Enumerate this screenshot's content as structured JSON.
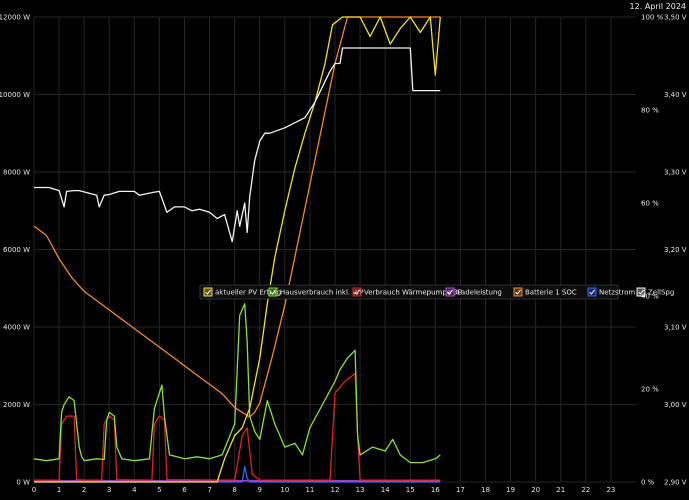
{
  "date_label": "12. April 2024",
  "chart_data": {
    "type": "line",
    "title": "",
    "xlim": [
      0,
      24
    ],
    "x_ticks": [
      "0",
      "1",
      "2",
      "3",
      "4",
      "5",
      "6",
      "7",
      "8",
      "9",
      "10",
      "11",
      "12",
      "13",
      "14",
      "15",
      "16",
      "17",
      "18",
      "19",
      "20",
      "21",
      "22",
      "23"
    ],
    "left_axis": {
      "ylim": [
        0,
        12000
      ],
      "ticks": [
        "0 W",
        "2000 W",
        "4000 W",
        "6000 W",
        "8000 W",
        "10000 W",
        "12000 W"
      ]
    },
    "pct_axis": {
      "ylim": [
        0,
        100
      ],
      "ticks": [
        "0 %",
        "20 %",
        "40 %",
        "60 %",
        "80 %",
        "100 %"
      ]
    },
    "volt_axis": {
      "ylim": [
        2.9,
        3.5
      ],
      "ticks": [
        "2,90 V",
        "3,00 V",
        "3,10 V",
        "3,20 V",
        "3,30 V",
        "3,40 V",
        "3,50 V"
      ]
    },
    "grid": true,
    "legend_position": "center-right",
    "series": [
      {
        "name": "aktueller PV Ertrag",
        "color": "#f2df30",
        "axis": "left",
        "x": [
          0,
          7.3,
          7.6,
          8.0,
          8.3,
          8.6,
          9.0,
          9.3,
          9.6,
          10.0,
          10.4,
          10.8,
          11.2,
          11.6,
          11.9,
          12.3,
          12.7,
          13.0,
          13.4,
          13.8,
          14.2,
          14.6,
          15.0,
          15.4,
          15.8,
          16.0,
          16.2
        ],
        "y": [
          0,
          0,
          600,
          1200,
          1400,
          1900,
          3200,
          4600,
          5800,
          7000,
          8100,
          9000,
          9800,
          10800,
          11800,
          12000,
          12000,
          12000,
          11500,
          12000,
          11300,
          11700,
          12000,
          11600,
          12000,
          10500,
          12000
        ]
      },
      {
        "name": "Hausverbrauch inkl. WP",
        "color": "#86e23c",
        "axis": "left",
        "x": [
          0,
          0.5,
          1.0,
          1.1,
          1.2,
          1.4,
          1.6,
          1.8,
          1.9,
          2.0,
          2.5,
          2.8,
          2.9,
          3.0,
          3.2,
          3.3,
          3.5,
          4.0,
          4.6,
          4.8,
          5.0,
          5.1,
          5.2,
          5.4,
          6.0,
          6.5,
          7.0,
          7.5,
          8.0,
          8.2,
          8.4,
          8.5,
          8.6,
          8.8,
          9.0,
          9.3,
          9.6,
          10.0,
          10.4,
          10.7,
          11.0,
          11.5,
          12.0,
          12.2,
          12.5,
          12.8,
          12.9,
          13.0,
          13.5,
          14.0,
          14.3,
          14.6,
          15.0,
          15.5,
          16.0,
          16.2
        ],
        "y": [
          600,
          550,
          600,
          1800,
          2000,
          2200,
          2100,
          900,
          650,
          550,
          600,
          580,
          1600,
          1800,
          1700,
          900,
          600,
          550,
          600,
          1900,
          2300,
          2500,
          1700,
          700,
          600,
          650,
          600,
          700,
          1500,
          4300,
          4600,
          3600,
          1700,
          1300,
          1100,
          2100,
          1500,
          900,
          1000,
          700,
          1400,
          2000,
          2600,
          2900,
          3200,
          3400,
          1200,
          700,
          900,
          800,
          1100,
          700,
          500,
          500,
          600,
          700
        ]
      },
      {
        "name": "Verbrauch Wärmepumpe 3P",
        "color": "#e02222",
        "axis": "left",
        "x": [
          0,
          1.0,
          1.1,
          1.3,
          1.6,
          1.7,
          2.0,
          2.7,
          2.8,
          3.0,
          3.2,
          3.3,
          4.7,
          4.8,
          5.0,
          5.2,
          5.3,
          8.0,
          8.3,
          8.5,
          8.7,
          9.0,
          11.8,
          12.0,
          12.4,
          12.8,
          12.9,
          13.0,
          16.2
        ],
        "y": [
          50,
          50,
          1500,
          1700,
          1700,
          60,
          50,
          50,
          1500,
          1700,
          1600,
          60,
          50,
          1500,
          1700,
          1600,
          60,
          50,
          1200,
          1400,
          200,
          50,
          50,
          2300,
          2600,
          2800,
          1200,
          50,
          50
        ]
      },
      {
        "name": "Ladeleistung",
        "color": "#b04ad8",
        "axis": "left",
        "x": [
          0,
          16.2
        ],
        "y": [
          30,
          30
        ]
      },
      {
        "name": "Batterie 1 SOC",
        "color": "#f08a2a",
        "axis": "pct",
        "x": [
          0,
          0.5,
          1.0,
          1.5,
          2.0,
          2.5,
          3.0,
          3.5,
          4.0,
          4.5,
          5.0,
          5.5,
          6.0,
          6.5,
          7.0,
          7.5,
          8.0,
          8.3,
          8.6,
          8.8,
          9.0,
          9.5,
          10.0,
          10.5,
          11.0,
          11.5,
          12.0,
          12.5,
          13.0,
          14.0,
          15.0,
          16.0,
          16.2
        ],
        "y": [
          55,
          53,
          48,
          44,
          41,
          39,
          37,
          35,
          33,
          31,
          29,
          27,
          25,
          23,
          21,
          19,
          16,
          15,
          14,
          15,
          17,
          27,
          38,
          51,
          64,
          77,
          90,
          100,
          100,
          100,
          100,
          100,
          100
        ]
      },
      {
        "name": "Netzstrom",
        "color": "#3566ff",
        "axis": "left",
        "x": [
          0,
          8.3,
          8.4,
          8.5,
          8.6,
          16.2
        ],
        "y": [
          0,
          0,
          400,
          100,
          0,
          0
        ]
      },
      {
        "name": "ZellSpg",
        "color": "#f4f4f4",
        "axis": "volt",
        "x": [
          0,
          0.6,
          1.0,
          1.2,
          1.3,
          1.6,
          1.8,
          2.5,
          2.6,
          2.8,
          3.0,
          3.4,
          4.0,
          4.2,
          4.8,
          5.0,
          5.3,
          5.6,
          6.0,
          6.3,
          6.6,
          7.0,
          7.3,
          7.6,
          7.9,
          8.1,
          8.2,
          8.4,
          8.5,
          8.6,
          8.8,
          9.0,
          9.2,
          9.4,
          10.0,
          10.8,
          11.2,
          11.5,
          11.8,
          12.0,
          12.2,
          12.3,
          12.6,
          13.0,
          14.0,
          15.0,
          15.1,
          15.3,
          16.2
        ],
        "y": [
          3.28,
          3.28,
          3.276,
          3.255,
          3.275,
          3.276,
          3.276,
          3.27,
          3.255,
          3.27,
          3.271,
          3.275,
          3.275,
          3.27,
          3.274,
          3.275,
          3.248,
          3.255,
          3.255,
          3.25,
          3.252,
          3.248,
          3.24,
          3.245,
          3.21,
          3.25,
          3.23,
          3.26,
          3.222,
          3.268,
          3.315,
          3.34,
          3.35,
          3.35,
          3.357,
          3.37,
          3.39,
          3.41,
          3.43,
          3.44,
          3.44,
          3.46,
          3.46,
          3.46,
          3.46,
          3.46,
          3.405,
          3.405,
          3.405
        ]
      }
    ]
  }
}
